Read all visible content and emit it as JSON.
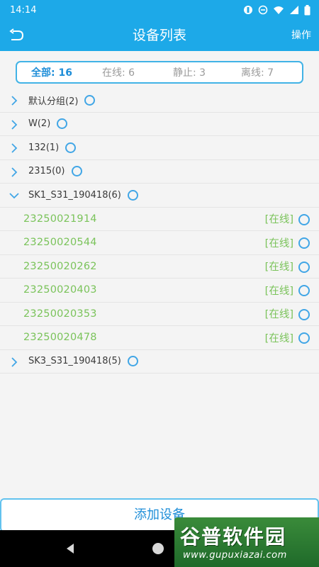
{
  "status_bar": {
    "time": "14:14"
  },
  "header": {
    "title": "设备列表",
    "action_label": "操作"
  },
  "summary": {
    "total": "全部: 16",
    "online": "在线: 6",
    "static": "静止: 3",
    "offline": "离线: 7"
  },
  "groups": [
    {
      "label": "默认分组(2)"
    },
    {
      "label": "W(2)"
    },
    {
      "label": "132(1)"
    },
    {
      "label": "2315(0)"
    },
    {
      "label": "SK1_S31_190418(6)"
    },
    {
      "label": "SK3_S31_190418(5)"
    }
  ],
  "devices": [
    {
      "id": "23250021914",
      "status": "[在线]"
    },
    {
      "id": "23250020544",
      "status": "[在线]"
    },
    {
      "id": "23250020262",
      "status": "[在线]"
    },
    {
      "id": "23250020403",
      "status": "[在线]"
    },
    {
      "id": "23250020353",
      "status": "[在线]"
    },
    {
      "id": "23250020478",
      "status": "[在线]"
    }
  ],
  "add_button_label": "添加设备",
  "watermark": {
    "brand": "谷普软件园",
    "url": "www.gupuxiazai.com"
  },
  "colors": {
    "primary": "#1da9e8",
    "online_text": "#7ac35a",
    "circle_border": "#41a6e6"
  }
}
